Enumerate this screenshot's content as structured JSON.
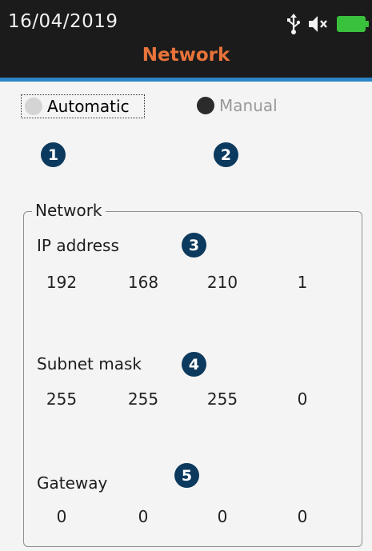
{
  "status_bar": {
    "date": "16/04/2019",
    "icons": [
      "usb-icon",
      "mute-icon",
      "battery-icon"
    ]
  },
  "header": {
    "title": "Network"
  },
  "mode": {
    "options": [
      {
        "label": "Automatic",
        "selected": true
      },
      {
        "label": "Manual",
        "selected": false
      }
    ]
  },
  "badges": [
    "1",
    "2",
    "3",
    "4",
    "5"
  ],
  "network": {
    "legend": "Network",
    "ip_address": {
      "label": "IP address",
      "octets": [
        "192",
        "168",
        "210",
        "1"
      ]
    },
    "subnet_mask": {
      "label": "Subnet mask",
      "octets": [
        "255",
        "255",
        "255",
        "0"
      ]
    },
    "gateway": {
      "label": "Gateway",
      "octets": [
        "0",
        "0",
        "0",
        "0"
      ]
    }
  },
  "colors": {
    "header_bg": "#1b1b1b",
    "title": "#e8733a",
    "accent_line": "#2a84c6",
    "badge": "#0c3a5e",
    "battery": "#39c03c"
  }
}
